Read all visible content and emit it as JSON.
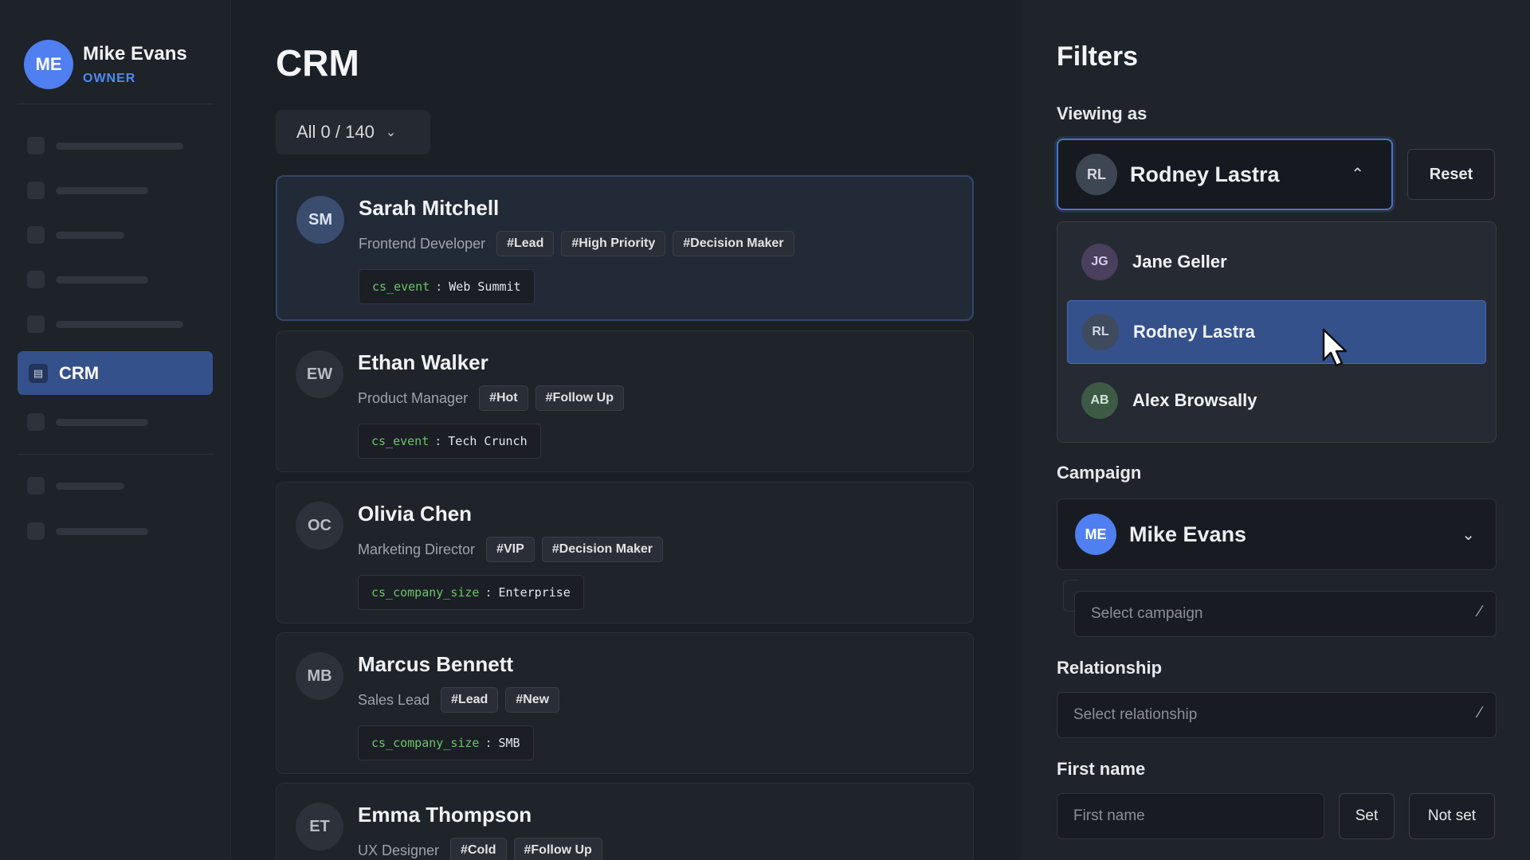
{
  "sidebar": {
    "profile": {
      "initials": "ME",
      "name": "Mike Evans",
      "role": "OWNER"
    },
    "active_nav": {
      "icon": "list-icon",
      "label": "CRM"
    }
  },
  "main": {
    "title": "CRM",
    "count_selector": {
      "label": "All 0 / 140"
    },
    "contacts": [
      {
        "initials": "SM",
        "name": "Sarah Mitchell",
        "role": "Frontend Developer",
        "tags": [
          "#Lead",
          "#High Priority",
          "#Decision Maker"
        ],
        "prop_key": "cs_event",
        "prop_value": "Web Summit",
        "selected": true
      },
      {
        "initials": "EW",
        "name": "Ethan Walker",
        "role": "Product Manager",
        "tags": [
          "#Hot",
          "#Follow Up"
        ],
        "prop_key": "cs_event",
        "prop_value": "Tech Crunch"
      },
      {
        "initials": "OC",
        "name": "Olivia Chen",
        "role": "Marketing Director",
        "tags": [
          "#VIP",
          "#Decision Maker"
        ],
        "prop_key": "cs_company_size",
        "prop_value": "Enterprise"
      },
      {
        "initials": "MB",
        "name": "Marcus Bennett",
        "role": "Sales Lead",
        "tags": [
          "#Lead",
          "#New"
        ],
        "prop_key": "cs_company_size",
        "prop_value": "SMB"
      },
      {
        "initials": "ET",
        "name": "Emma Thompson",
        "role": "UX Designer",
        "tags": [
          "#Cold",
          "#Follow Up"
        ]
      }
    ]
  },
  "filters": {
    "title": "Filters",
    "viewing_as": {
      "label": "Viewing as",
      "selected": {
        "initials": "RL",
        "name": "Rodney Lastra"
      },
      "reset_label": "Reset",
      "options": [
        {
          "initials": "JG",
          "name": "Jane Geller",
          "color": "#4a3f5c"
        },
        {
          "initials": "RL",
          "name": "Rodney Lastra",
          "color": "#3f4a5e"
        },
        {
          "initials": "AB",
          "name": "Alex Browsally",
          "color": "#3d5a45"
        }
      ]
    },
    "campaign": {
      "label": "Campaign",
      "selected": {
        "initials": "ME",
        "name": "Mike Evans"
      },
      "placeholder": "Select campaign"
    },
    "relationship": {
      "label": "Relationship",
      "placeholder": "Select relationship"
    },
    "first_name": {
      "label": "First name",
      "placeholder": "First name",
      "set_label": "Set",
      "not_set_label": "Not set"
    }
  },
  "colors": {
    "accent": "#4f7ff0",
    "active_bg": "#35518c",
    "prop_key": "#6cc36a"
  }
}
